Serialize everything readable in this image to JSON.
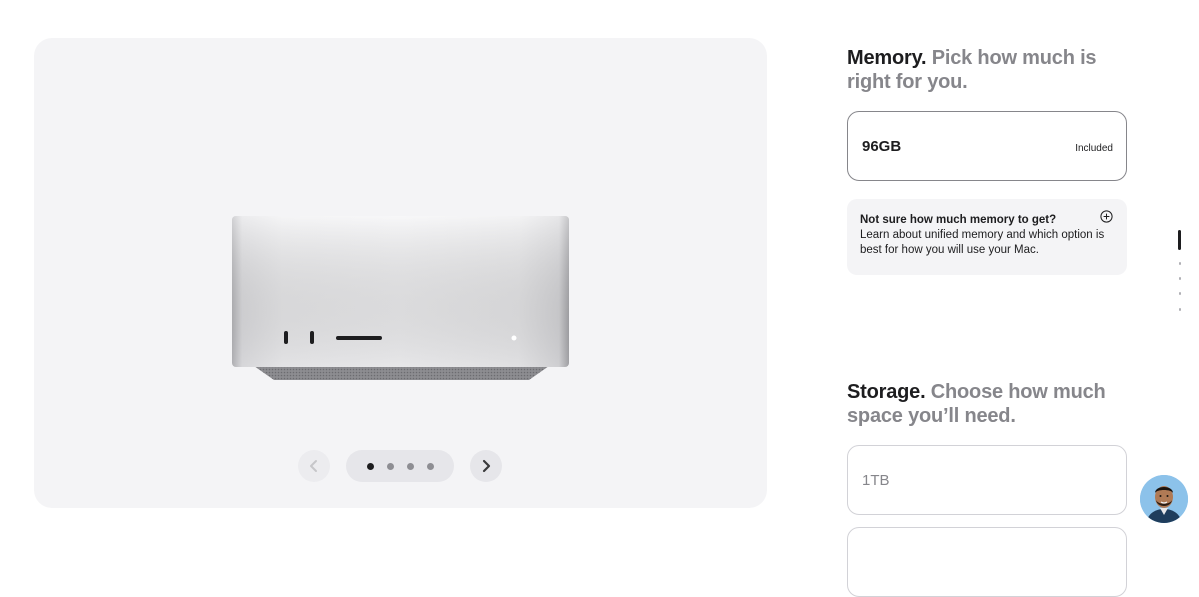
{
  "gallery": {
    "product_image": "mac-studio-front",
    "prev_label": "previous-image",
    "next_label": "next-image",
    "dot_count": 4,
    "active_dot": 1
  },
  "memory": {
    "title_strong": "Memory.",
    "title_muted": "Pick how much is right for you.",
    "options": [
      {
        "label": "96GB",
        "price": "Included"
      }
    ],
    "help": {
      "title": "Not sure how much memory to get?",
      "body": "Learn about unified memory and which option is best for how you will use your Mac."
    }
  },
  "storage": {
    "title_strong": "Storage.",
    "title_muted": "Choose how much space you’ll need.",
    "options": [
      {
        "label": "1TB"
      }
    ]
  },
  "colors": {
    "accent_dark": "#1d1d1f",
    "muted_text": "#86868b",
    "panel_bg": "#f4f4f6"
  },
  "icons": {
    "prev": "chevron-left-icon",
    "next": "chevron-right-icon",
    "help": "plus-circle-icon",
    "chat": "avatar-chat-icon"
  }
}
